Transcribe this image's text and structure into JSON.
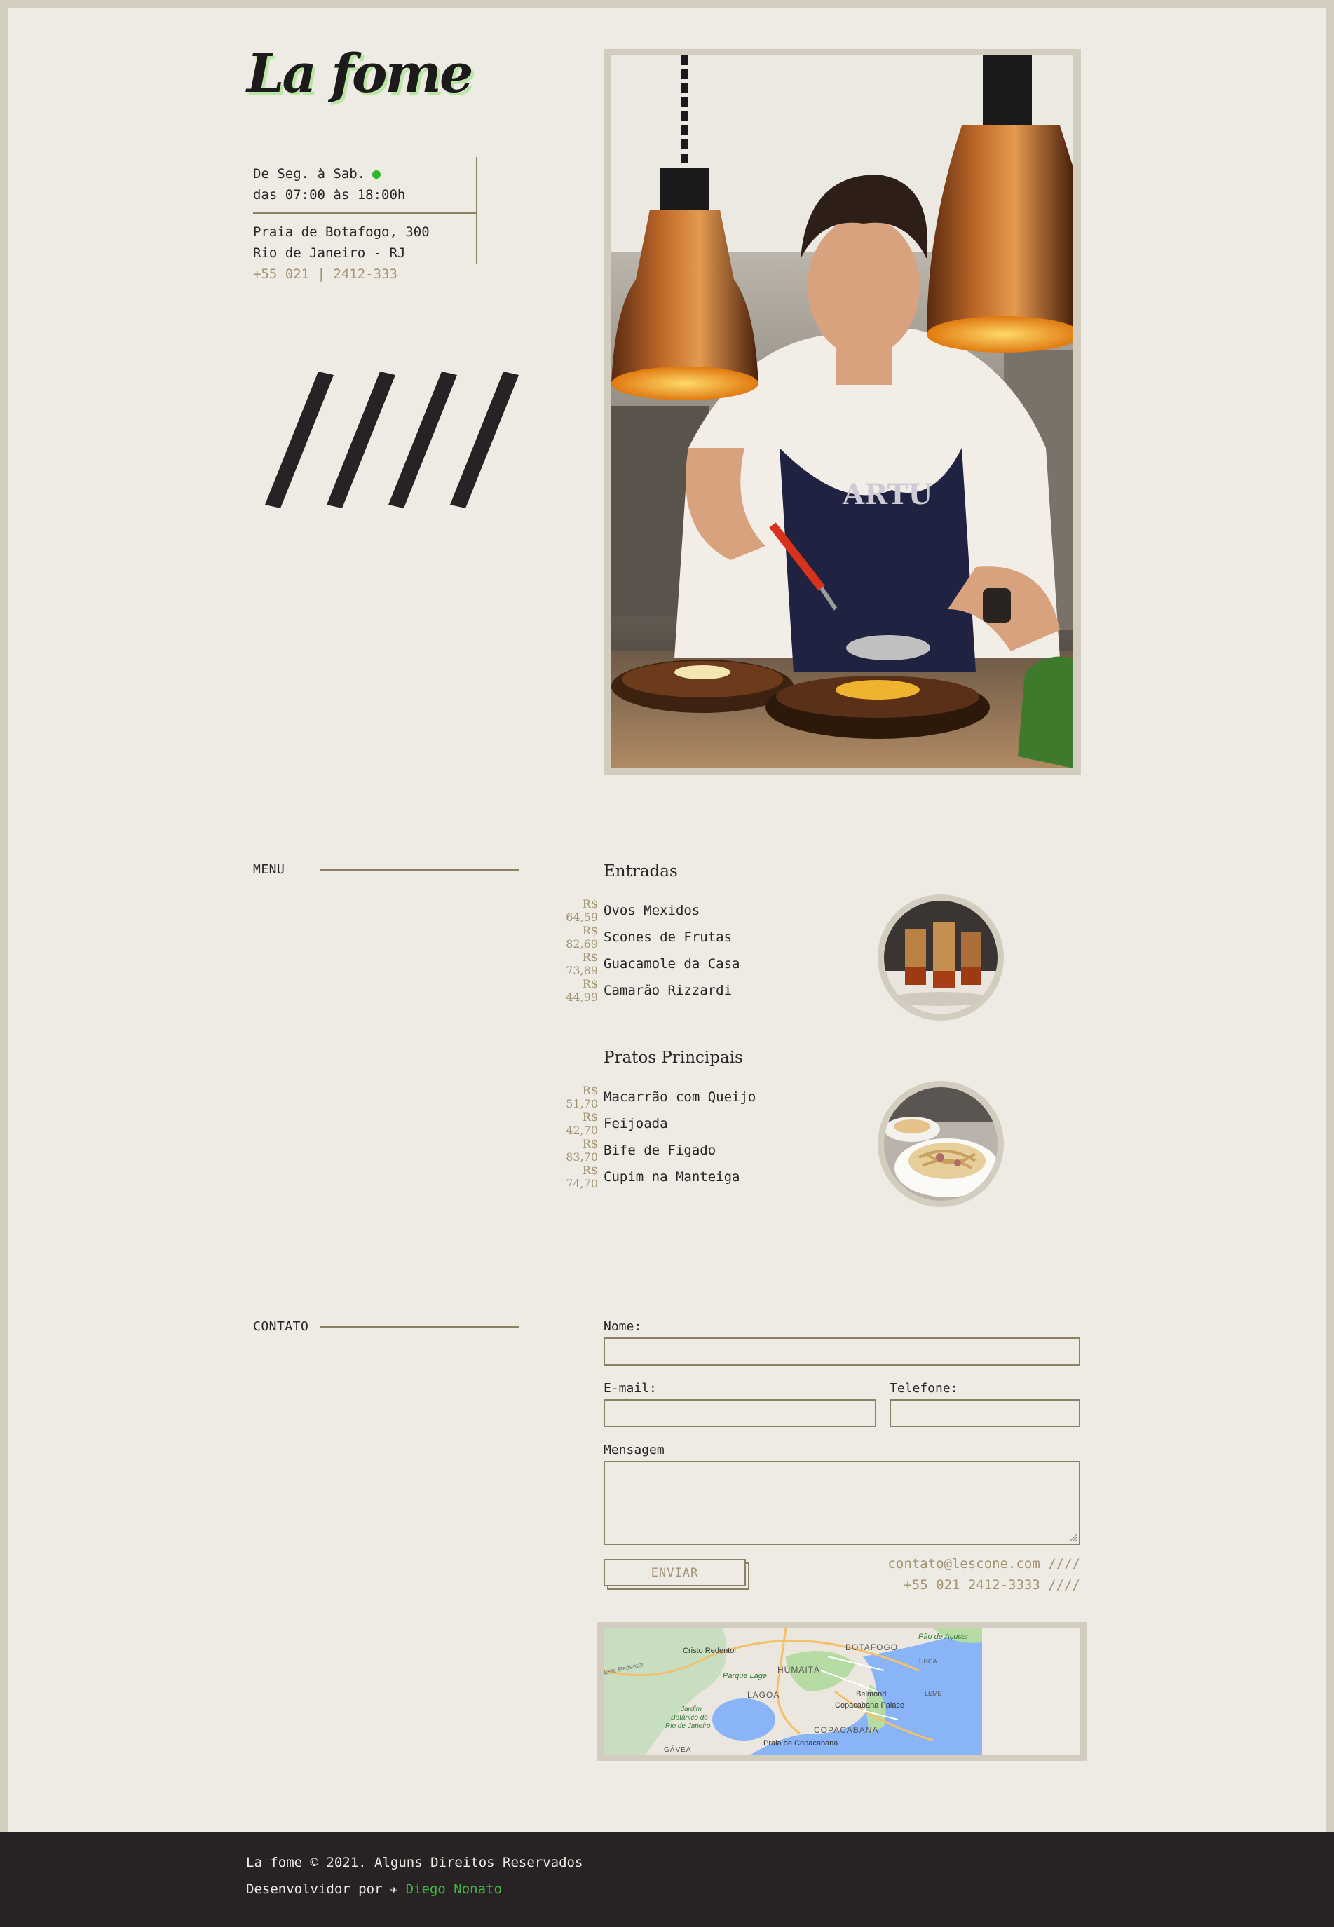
{
  "brand": {
    "logo": "La fome"
  },
  "info": {
    "days": "De Seg. à Sab.",
    "hours": "das 07:00 às 18:00h",
    "address_line1": "Praia de Botafogo, 300",
    "address_line2": "Rio de Janeiro - RJ",
    "phone": "+55 021 | 2412-333"
  },
  "menu": {
    "label": "MENU",
    "categories": [
      {
        "title": "Entradas",
        "items": [
          {
            "price": "R$ 64,59",
            "name": "Ovos Mexidos"
          },
          {
            "price": "R$ 82,69",
            "name": "Scones de Frutas"
          },
          {
            "price": "R$ 73,89",
            "name": "Guacamole da Casa"
          },
          {
            "price": "R$ 44,99",
            "name": "Camarão Rizzardi"
          }
        ]
      },
      {
        "title": "Pratos Principais",
        "items": [
          {
            "price": "R$ 51,70",
            "name": "Macarrão com Queijo"
          },
          {
            "price": "R$ 42,70",
            "name": "Feijoada"
          },
          {
            "price": "R$ 83,70",
            "name": "Bife de Figado"
          },
          {
            "price": "R$ 74,70",
            "name": "Cupim na Manteiga"
          }
        ]
      }
    ]
  },
  "contact": {
    "label": "CONTATO",
    "name_label": "Nome:",
    "email_label": "E-mail:",
    "phone_label": "Telefone:",
    "message_label": "Mensagem",
    "send_label": "ENVIAR",
    "email": "contato@lescone.com ////",
    "phone": "+55 021 2412-3333 ////"
  },
  "map": {
    "labels": [
      "Cristo Redentor",
      "BOTAFOGO",
      "Pão de Açucar",
      "Estr. Redentor",
      "Parque Lage",
      "HUMAITÁ",
      "URCA",
      "LAGOA",
      "Belmond",
      "Copacabana Palace",
      "LEME",
      "Jardim",
      "Botânico do",
      "Rio de Janeiro",
      "COPACABANA",
      "Praia de Copacabana",
      "GÁVEA"
    ]
  },
  "footer": {
    "copyright": "La fome © 2021. Alguns Direitos Reservados",
    "dev_prefix": "Desenvolvidor por",
    "rocket_icon": "rocket-icon",
    "dev_name": "Diego Nonato"
  },
  "colors": {
    "background": "#edebe4",
    "frame": "#d3cdbf",
    "accent_brown": "#8b7f64",
    "price": "#a59270",
    "dark": "#282224",
    "status_green": "#2db52d",
    "link_green": "#3bbd3b"
  }
}
